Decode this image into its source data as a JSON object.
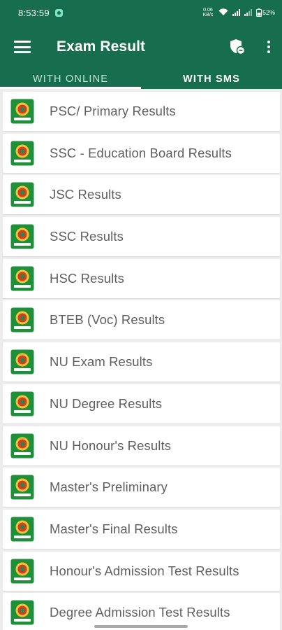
{
  "status_bar": {
    "time": "8:53:59",
    "net_speed": "0.06 KB/s",
    "battery": "52%"
  },
  "app_bar": {
    "title": "Exam Result",
    "menu_icon": "hamburger-menu-icon",
    "privacy_icon": "shield-icon",
    "overflow_icon": "more-vert-icon"
  },
  "tabs": [
    {
      "label": "WITH ONLINE",
      "selected": true
    },
    {
      "label": "WITH SMS",
      "selected": false
    }
  ],
  "results": [
    {
      "label": "PSC/ Primary Results"
    },
    {
      "label": "SSC - Education Board Results"
    },
    {
      "label": "JSC Results"
    },
    {
      "label": "SSC Results"
    },
    {
      "label": "HSC Results"
    },
    {
      "label": "BTEB (Voc) Results"
    },
    {
      "label": "NU Exam Results"
    },
    {
      "label": "NU Degree Results"
    },
    {
      "label": "NU Honour's Results"
    },
    {
      "label": "Master's Preliminary"
    },
    {
      "label": "Master's Final Results"
    },
    {
      "label": "Honour's Admission Test Results"
    },
    {
      "label": "Degree Admission Test Results"
    }
  ],
  "colors": {
    "primary": "#166e4e",
    "background": "#ededed",
    "item_text": "#5f5f5f",
    "logo_green": "#1f8f3a",
    "logo_red": "#d63a2a"
  }
}
